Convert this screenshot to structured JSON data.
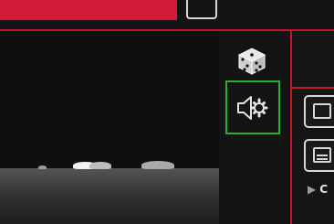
{
  "top": {
    "accent_color": "#d31a36"
  },
  "toolbar": {
    "dice_icon": "dice-icon",
    "sound_settings_icon": "speaker-gear-icon",
    "selected_outline_color": "#27b12d"
  },
  "side_list": {
    "items": [
      {
        "icon": "disc-icon"
      },
      {
        "icon": "monitor-icon"
      }
    ],
    "expand_label": "C"
  }
}
